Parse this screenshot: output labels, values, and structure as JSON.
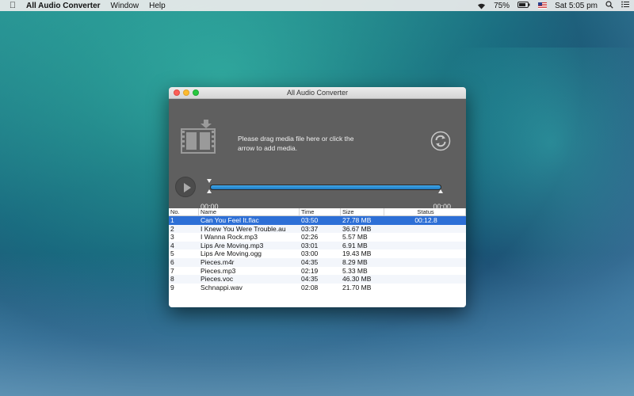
{
  "menubar": {
    "app_name": "All Audio Converter",
    "menus": [
      "Window",
      "Help"
    ],
    "battery": "75%",
    "clock": "Sat 5:05 pm"
  },
  "window": {
    "title": "All Audio Converter",
    "drop_text": "Please drag media file here or click the arrow to add media.",
    "time_start": "00:00",
    "time_end": "00:00",
    "progress": 1.0
  },
  "table": {
    "headers": [
      "No.",
      "Name",
      "Time",
      "Size",
      "Status"
    ],
    "rows": [
      {
        "no": "1",
        "name": "Can You Feel It.flac",
        "time": "03:50",
        "size": "27.78  MB",
        "status": "00:12.8",
        "selected": true
      },
      {
        "no": "2",
        "name": "I Knew You Were Trouble.au",
        "time": "03:37",
        "size": "36.67  MB",
        "status": ""
      },
      {
        "no": "3",
        "name": "I Wanna Rock.mp3",
        "time": "02:26",
        "size": "5.57  MB",
        "status": ""
      },
      {
        "no": "4",
        "name": "Lips Are Moving.mp3",
        "time": "03:01",
        "size": "6.91  MB",
        "status": ""
      },
      {
        "no": "5",
        "name": "Lips Are Moving.ogg",
        "time": "03:00",
        "size": "19.43  MB",
        "status": ""
      },
      {
        "no": "6",
        "name": "Pieces.m4r",
        "time": "04:35",
        "size": "8.29  MB",
        "status": ""
      },
      {
        "no": "7",
        "name": "Pieces.mp3",
        "time": "02:19",
        "size": "5.33  MB",
        "status": ""
      },
      {
        "no": "8",
        "name": "Pieces.voc",
        "time": "04:35",
        "size": "46.30  MB",
        "status": ""
      },
      {
        "no": "9",
        "name": "Schnappi.wav",
        "time": "02:08",
        "size": "21.70  MB",
        "status": ""
      }
    ]
  }
}
